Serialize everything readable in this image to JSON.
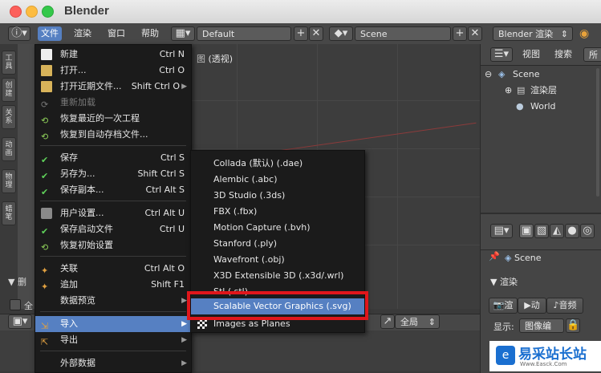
{
  "window": {
    "title": "Blender"
  },
  "header": {
    "menus": [
      {
        "label": "文件",
        "active": true
      },
      {
        "label": "渲染",
        "active": false
      },
      {
        "label": "窗口",
        "active": false
      },
      {
        "label": "帮助",
        "active": false
      }
    ],
    "layout_field": "Default",
    "scene_field": "Scene",
    "engine_field": "Blender 渲染"
  },
  "viewport": {
    "label": "(透视)"
  },
  "toolstrip": {
    "tabs": [
      "工具",
      "创建",
      "关系",
      "动画",
      "物理",
      "蜡笔"
    ]
  },
  "file_menu": {
    "items": [
      {
        "label": "新建",
        "shortcut": "Ctrl N",
        "icon": "new-file-icon"
      },
      {
        "label": "打开...",
        "shortcut": "Ctrl O",
        "icon": "open-folder-icon"
      },
      {
        "label": "打开近期文件...",
        "shortcut": "Shift Ctrl O",
        "icon": "open-recent-icon",
        "submenu": true
      },
      {
        "label": "重新加载",
        "shortcut": "",
        "icon": "reload-icon",
        "disabled": true
      },
      {
        "label": "恢复最近的一次工程",
        "shortcut": "",
        "icon": "recover-last-icon"
      },
      {
        "label": "恢复到自动存档文件...",
        "shortcut": "",
        "icon": "recover-auto-icon"
      },
      {
        "label": "保存",
        "shortcut": "Ctrl S",
        "icon": "save-check-icon"
      },
      {
        "label": "另存为...",
        "shortcut": "Shift Ctrl S",
        "icon": "save-as-icon"
      },
      {
        "label": "保存副本...",
        "shortcut": "Ctrl Alt S",
        "icon": "save-copy-icon"
      },
      {
        "label": "用户设置...",
        "shortcut": "Ctrl Alt U",
        "icon": "user-prefs-icon"
      },
      {
        "label": "保存启动文件",
        "shortcut": "Ctrl U",
        "icon": "save-startup-icon"
      },
      {
        "label": "恢复初始设置",
        "shortcut": "",
        "icon": "factory-settings-icon"
      },
      {
        "label": "关联",
        "shortcut": "Ctrl Alt O",
        "icon": "link-icon"
      },
      {
        "label": "追加",
        "shortcut": "Shift F1",
        "icon": "append-icon"
      },
      {
        "label": "数据预览",
        "shortcut": "",
        "icon": "",
        "submenu": true
      },
      {
        "label": "导入",
        "shortcut": "",
        "icon": "import-icon",
        "submenu": true,
        "highlighted": true
      },
      {
        "label": "导出",
        "shortcut": "",
        "icon": "export-icon",
        "submenu": true
      },
      {
        "label": "外部数据",
        "shortcut": "",
        "icon": "external-data-icon",
        "submenu": true
      }
    ]
  },
  "import_submenu": {
    "items": [
      {
        "label": "Collada (默认) (.dae)"
      },
      {
        "label": "Alembic (.abc)"
      },
      {
        "label": "3D Studio (.3ds)"
      },
      {
        "label": "FBX (.fbx)"
      },
      {
        "label": "Motion Capture (.bvh)"
      },
      {
        "label": "Stanford (.ply)"
      },
      {
        "label": "Wavefront (.obj)"
      },
      {
        "label": "X3D Extensible 3D (.x3d/.wrl)"
      },
      {
        "label": "Stl (.stl)"
      },
      {
        "label": "Scalable Vector Graphics (.svg)",
        "highlighted": true
      },
      {
        "label": "Images as Planes"
      }
    ]
  },
  "outliner": {
    "header": [
      "视图",
      "搜索",
      "所"
    ],
    "rows": [
      "Scene",
      "渲染层",
      "World"
    ]
  },
  "properties": {
    "scene_label": "Scene",
    "render_section": "渲染",
    "render_buttons": [
      "渲",
      "动",
      "音频"
    ],
    "display_label": "显示:",
    "display_value": "图像编"
  },
  "bottom": {
    "delete_label": "删",
    "global_label": "全局",
    "all_label": "全"
  },
  "watermark": {
    "text": "易采站长站",
    "sub": "Www.Easck.Com"
  },
  "colors": {
    "accent": "#5680c2",
    "highlight_box": "#e0161b"
  }
}
